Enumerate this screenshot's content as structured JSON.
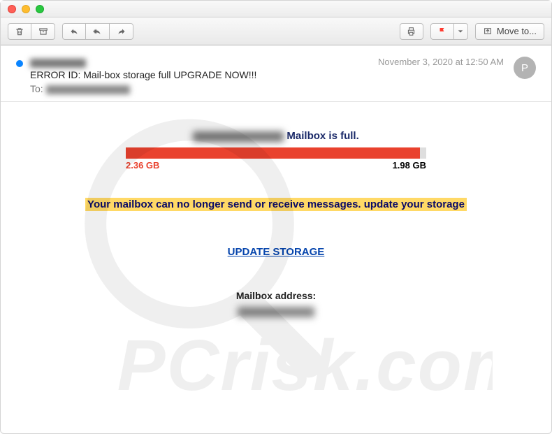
{
  "toolbar": {
    "move_to_label": "Move to..."
  },
  "header": {
    "subject": "ERROR ID: Mail-box storage full UPGRADE NOW!!!",
    "to_label": "To:",
    "date": "November 3, 2020 at 12:50 AM",
    "avatar_initial": "P"
  },
  "body": {
    "title_suffix": " Mailbox is full.",
    "storage_used": "2.36 GB",
    "storage_right": "1.98 GB",
    "warning_text": "Your mailbox can no longer send or receive messages. update your storage",
    "update_link_text": "UPDATE STORAGE",
    "mailbox_address_label": "Mailbox address:"
  }
}
